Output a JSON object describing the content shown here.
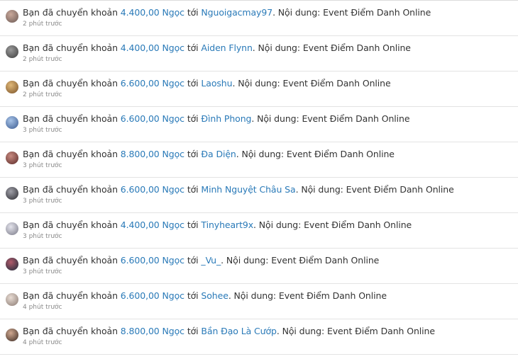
{
  "transfers": [
    {
      "prefix": "Bạn đã chuyển khoản",
      "amount": "4.400,00 Ngọc",
      "to": "tới",
      "user": "Nguoigacmay97",
      "suffix": ". Nội dung: Event Điểm Danh Online",
      "time": "2 phút trước",
      "avatar_colors": [
        "#c9a89a",
        "#6b5a55"
      ]
    },
    {
      "prefix": "Bạn đã chuyển khoản",
      "amount": "4.400,00 Ngọc",
      "to": "tới",
      "user": "Aiden Flynn",
      "suffix": ". Nội dung: Event Điểm Danh Online",
      "time": "2 phút trước",
      "avatar_colors": [
        "#9a9a9a",
        "#3c3c3c"
      ]
    },
    {
      "prefix": "Bạn đã chuyển khoản",
      "amount": "6.600,00 Ngọc",
      "to": "tới",
      "user": "Laoshu",
      "suffix": ". Nội dung: Event Điểm Danh Online",
      "time": "2 phút trước",
      "avatar_colors": [
        "#e0b878",
        "#7a5228"
      ]
    },
    {
      "prefix": "Bạn đã chuyển khoản",
      "amount": "6.600,00 Ngọc",
      "to": "tới",
      "user": "Đình Phong",
      "suffix": ". Nội dung: Event Điểm Danh Online",
      "time": "3 phút trước",
      "avatar_colors": [
        "#a8c4e8",
        "#3a5a90"
      ]
    },
    {
      "prefix": "Bạn đã chuyển khoản",
      "amount": "8.800,00 Ngọc",
      "to": "tới",
      "user": "Đa Diện",
      "suffix": ". Nội dung: Event Điểm Danh Online",
      "time": "3 phút trước",
      "avatar_colors": [
        "#c88a80",
        "#5a2a28"
      ]
    },
    {
      "prefix": "Bạn đã chuyển khoản",
      "amount": "6.600,00 Ngọc",
      "to": "tới",
      "user": "Minh Nguyệt Châu Sa",
      "suffix": ". Nội dung: Event Điểm Danh Online",
      "time": "3 phút trước",
      "avatar_colors": [
        "#a0a0a8",
        "#2a2a30"
      ]
    },
    {
      "prefix": "Bạn đã chuyển khoản",
      "amount": "4.400,00 Ngọc",
      "to": "tới",
      "user": "Tinyheart9x",
      "suffix": ". Nội dung: Event Điểm Danh Online",
      "time": "3 phút trước",
      "avatar_colors": [
        "#e4e4ec",
        "#7a7a88"
      ]
    },
    {
      "prefix": "Bạn đã chuyển khoản",
      "amount": "6.600,00 Ngọc",
      "to": "tới",
      "user": "_Vu_",
      "suffix": ". Nội dung: Event Điểm Danh Online",
      "time": "3 phút trước",
      "avatar_colors": [
        "#b05a6a",
        "#1a2a3a"
      ]
    },
    {
      "prefix": "Bạn đã chuyển khoản",
      "amount": "6.600,00 Ngọc",
      "to": "tới",
      "user": "Sohee",
      "suffix": ". Nội dung: Event Điểm Danh Online",
      "time": "4 phút trước",
      "avatar_colors": [
        "#e8dcd4",
        "#8a7a72"
      ]
    },
    {
      "prefix": "Bạn đã chuyển khoản",
      "amount": "8.800,00 Ngọc",
      "to": "tới",
      "user": "Bần Đạo Là Cướp",
      "suffix": ". Nội dung: Event Điểm Danh Online",
      "time": "4 phút trước",
      "avatar_colors": [
        "#d0a890",
        "#3a2a22"
      ]
    }
  ]
}
